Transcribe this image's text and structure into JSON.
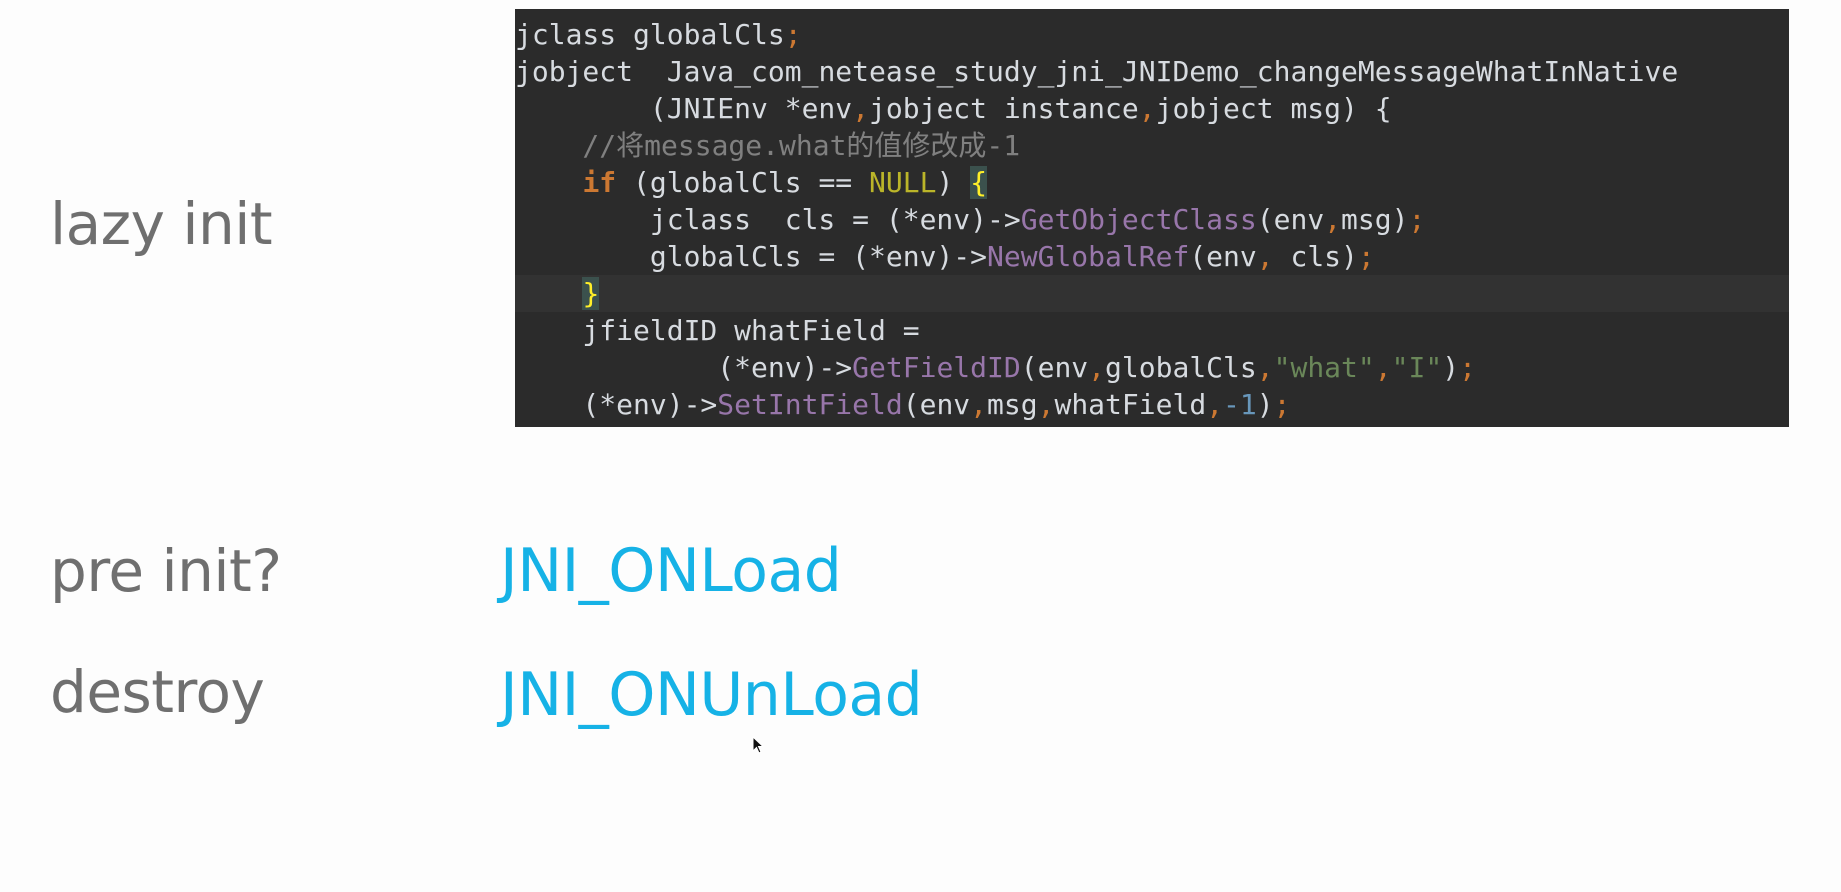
{
  "labels": {
    "lazy": "lazy init",
    "pre": "pre init?",
    "destroy": "destroy"
  },
  "values": {
    "onload": "JNI_ONLoad",
    "onunload": "JNI_ONUnLoad"
  },
  "code": {
    "l1_type": "jclass",
    "l1_name": " globalCls",
    "l1_end": ";",
    "l2_type": "jobject",
    "l2_fn": "  Java_com_netease_study_jni_JNIDemo_changeMessageWhatInNative",
    "l3_params": "        (JNIEnv *env",
    "l3_c1": ",",
    "l3_p2": "jobject instance",
    "l3_c2": ",",
    "l3_p3": "jobject msg) {",
    "l4_comment": "    //将message.what的值修改成-1",
    "l5_indent": "    ",
    "l5_if": "if",
    "l5_cond_a": " (globalCls == ",
    "l5_null": "NULL",
    "l5_cond_b": ") ",
    "l5_brace": "{",
    "l6_a": "        jclass  cls = (*env)->",
    "l6_fn": "GetObjectClass",
    "l6_b": "(env",
    "l6_c": ",",
    "l6_d": "msg)",
    "l6_e": ";",
    "l7_a": "        globalCls = (*env)->",
    "l7_fn": "NewGlobalRef",
    "l7_b": "(env",
    "l7_c": ",",
    "l7_d": " cls)",
    "l7_e": ";",
    "l8_indent": "    ",
    "l8_brace": "}",
    "l9": "    jfieldID whatField =",
    "l10_a": "            (*env)->",
    "l10_fn": "GetFieldID",
    "l10_b": "(env",
    "l10_c1": ",",
    "l10_d": "globalCls",
    "l10_c2": ",",
    "l10_s1": "\"what\"",
    "l10_c3": ",",
    "l10_s2": "\"I\"",
    "l10_e": ")",
    "l10_f": ";",
    "l11_a": "    (*env)->",
    "l11_fn": "SetIntField",
    "l11_b": "(env",
    "l11_c1": ",",
    "l11_d": "msg",
    "l11_c2": ",",
    "l11_e": "whatField",
    "l11_c3": ",",
    "l11_num": "-1",
    "l11_f": ")",
    "l11_g": ";"
  }
}
